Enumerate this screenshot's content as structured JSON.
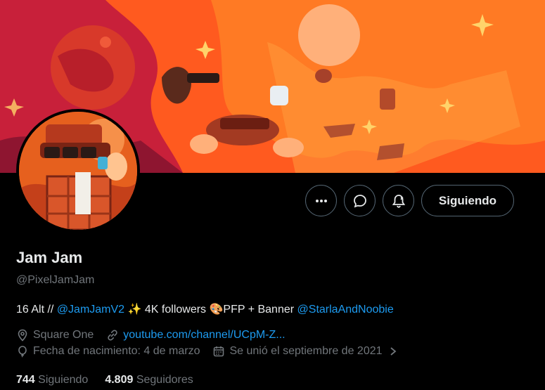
{
  "profile": {
    "name": "Jam Jam",
    "handle": "@PixelJamJam",
    "bio": {
      "prefix": "16 Alt // ",
      "mention1": "@JamJamV2",
      "sparkle": "✨",
      "middle": " 4K followers ",
      "palette": "🎨",
      "after_palette": "PFP + Banner ",
      "mention2": "@StarlaAndNoobie"
    },
    "location": "Square One",
    "website": "youtube.com/channel/UCpM-Z...",
    "birthday": "Fecha de nacimiento: 4 de marzo",
    "joined": "Se unió el septiembre de 2021",
    "following_count": "744",
    "following_label": "Siguiendo",
    "followers_count": "4.809",
    "followers_label": "Seguidores"
  },
  "actions": {
    "more_icon": "more-icon",
    "message_icon": "message-icon",
    "notify_icon": "notification-bell-icon",
    "follow_label": "Siguiendo"
  },
  "colors": {
    "accent": "#1d9bf0",
    "muted": "#71767b",
    "text": "#e7e9ea",
    "border": "#536471"
  }
}
